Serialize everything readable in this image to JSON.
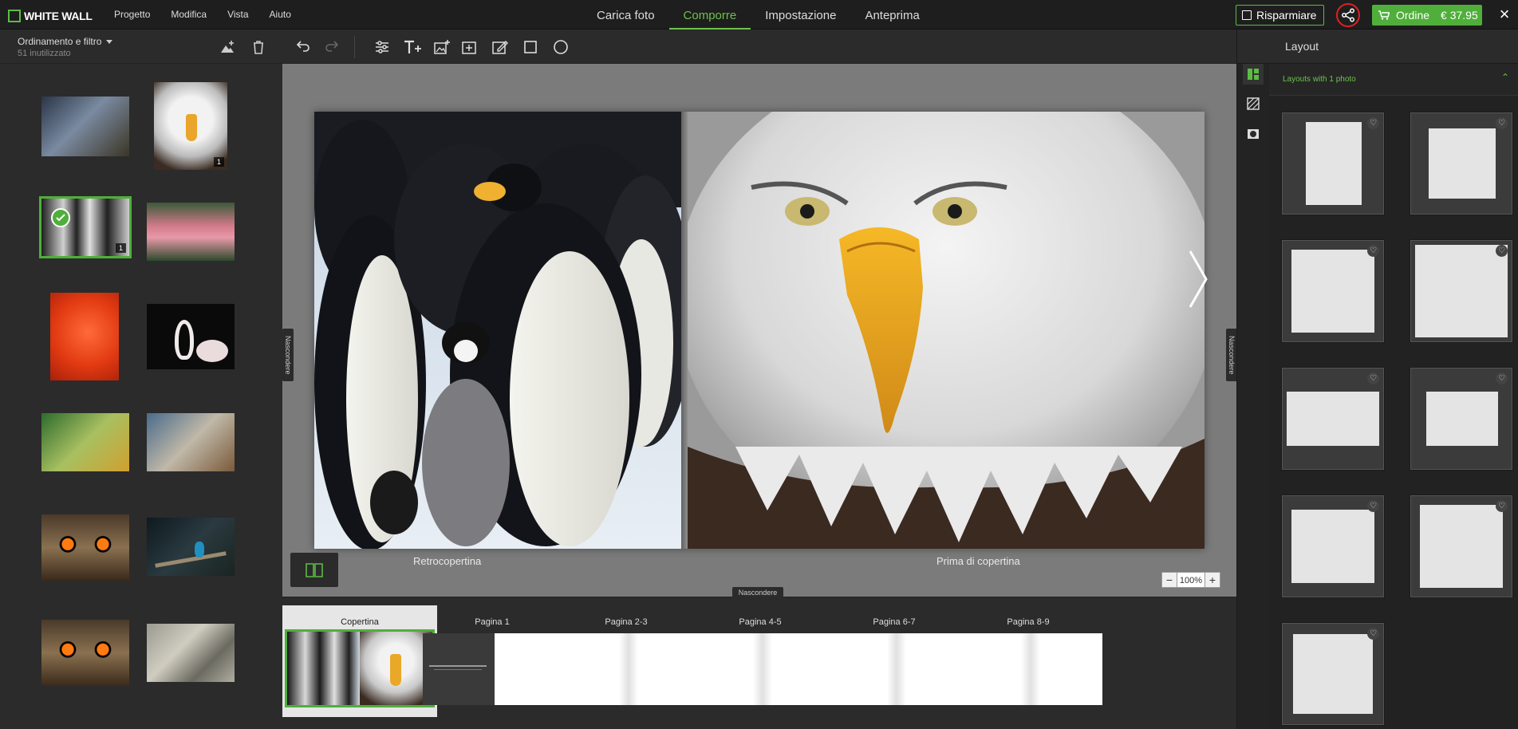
{
  "app": {
    "logo": "WHITE WALL",
    "menu": [
      "Progetto",
      "Modifica",
      "Vista",
      "Aiuto"
    ],
    "tabs": [
      "Carica foto",
      "Comporre",
      "Impostazione",
      "Anteprima"
    ],
    "active_tab": "Comporre",
    "save_label": "Risparmiare",
    "order_label": "Ordine",
    "order_price": "€ 37.95",
    "close_icon": "×"
  },
  "left_panel": {
    "sort_filter": "Ordinamento e filtro",
    "unused": "51 inutilizzato",
    "badges": [
      "1",
      "1"
    ]
  },
  "canvas": {
    "back_cover_label": "Retrocopertina",
    "front_cover_label": "Prima di copertina",
    "hide_label": "Nascondere",
    "zoom_value": "100%",
    "zoom_minus": "−",
    "zoom_plus": "+"
  },
  "strip": {
    "hide_label": "Nascondere",
    "pages": [
      "Copertina",
      "Pagina 1",
      "Pagina 2-3",
      "Pagina 4-5",
      "Pagina 6-7",
      "Pagina 8-9"
    ]
  },
  "right_panel": {
    "title": "Layout",
    "section": "Layouts with 1 photo",
    "heart_icon": "♡"
  },
  "colors": {
    "accent": "#4faf3a",
    "highlight_circle": "#e02020"
  }
}
